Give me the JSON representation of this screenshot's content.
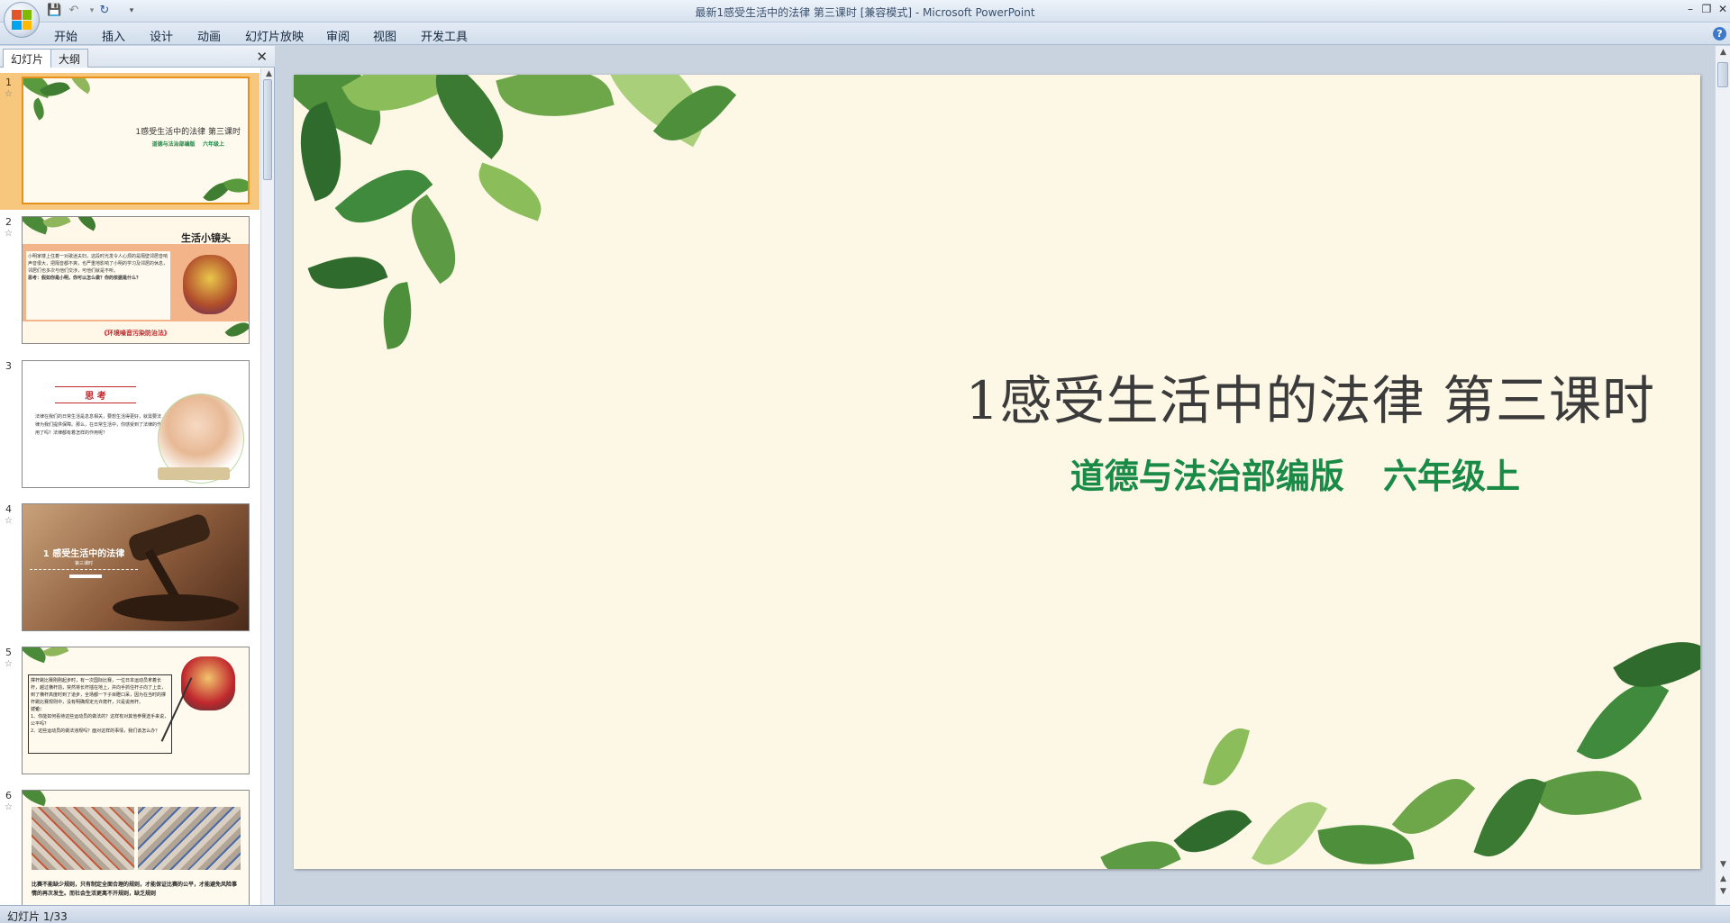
{
  "window": {
    "title": "最新1感受生活中的法律  第三课时 [兼容模式] - Microsoft PowerPoint",
    "controls": [
      "minimize-icon",
      "restore-icon",
      "close-icon"
    ]
  },
  "quick_access": [
    "save-icon",
    "undo-icon",
    "redo-icon",
    "customize-icon"
  ],
  "ribbon": {
    "tabs": [
      "开始",
      "插入",
      "设计",
      "动画",
      "幻灯片放映",
      "审阅",
      "视图",
      "开发工具"
    ]
  },
  "left_pane": {
    "tabs": [
      "幻灯片",
      "大纲"
    ],
    "close_icon": "close-icon",
    "slides": [
      {
        "number": "1",
        "title": "1感受生活中的法律  第三课时",
        "subtitle": "道德与法治部编版    六年级上"
      },
      {
        "number": "2",
        "heading": "生活小镜头",
        "body": "小明家楼上住着一对歌迷夫妇，这段时光发令人心烦的是隔壁邻居音响声音很大，把隔音都不爽，也严重地影响了小明的学习及邻居的休息，邻居们也多次与他们交涉，可他们就是不听。",
        "question": "思考：假如你是小明，你可以怎么做？你的依据是什么？",
        "footer": "《环境噪音污染防治法》"
      },
      {
        "number": "3",
        "heading": "思 考",
        "body": "法律在我们的日常生活是息息相关，要想生活得更好，就需要法律为我们提供保障。那么，在日常生活中，你感受到了法律的作用了吗？法律都有着怎样的作用呢？"
      },
      {
        "number": "4",
        "title": "1 感受生活中的法律",
        "subtitle": "第三课时"
      },
      {
        "number": "5",
        "body": "撑杆跳比赛刚刚起步时，有一次国际比赛，一位日本运动员拿着长杆，越过横杆前，突然将长杆插在地上，并向手抓住杆子向了上去，到了横杆高度时到了道步，全场都一下子目瞪口呆，因为在当时的撑杆跳比赛规则中，没有明确规定允许爬杆，只是说用杆。",
        "discussion_label": "讨论：",
        "q1": "1、你能如何看待这些运动员的做法的？这样有对其他参赛选手来说，公平吗？",
        "q2": "2、这些运动员的做法违规吗？面对这样的事情，我们该怎么办？"
      },
      {
        "number": "6",
        "body": "比赛不能缺少规则，只有制定全面合理的规则，才能保证比赛的公平，才能避免风险事情的再次发生。而社会生活更离不开规则，缺乏规则"
      }
    ]
  },
  "slide": {
    "title": "1感受生活中的法律  第三课时",
    "subtitle": "道德与法治部编版    六年级上",
    "colors": {
      "title": "#3b3b3b",
      "subtitle": "#1a8a47",
      "background": "#fdf7e6",
      "leaf": "#3f8a3c"
    }
  },
  "status": {
    "text": "幻灯片 1/33"
  }
}
